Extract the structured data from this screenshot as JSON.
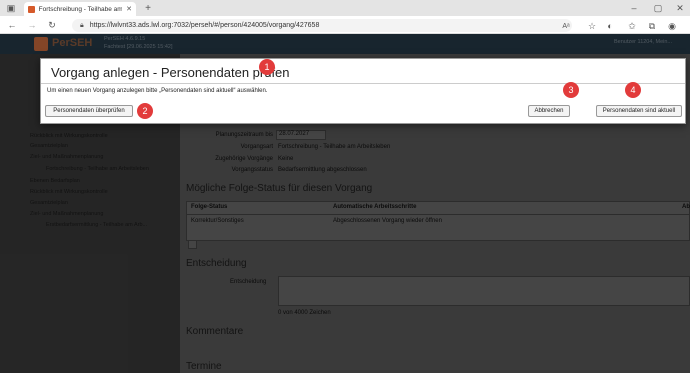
{
  "browser": {
    "tab_title": "Fortschreibung - Teilhabe am Arb...",
    "url": "https://lwlvnt33.ads.lwl.org:7032/perseh/#/person/424005/vorgang/427658"
  },
  "app": {
    "name": "PerSEH",
    "version": "PerSEH 4.6.9.15",
    "fachtest": "Fachtest [29.06.2025 15:42]",
    "user": "Benutzer 11204, Mein..."
  },
  "sidebar": {
    "items": [
      "Rückblick mit Wirkungskontrolle",
      "Gesamtzielplan",
      "Ziel- und Maßnahmenplanung",
      "Fortschreibung - Teilhabe am Arbeitsleben",
      "Ebenen Bedarfsplan",
      "Rückblick mit Wirkungskontrolle",
      "Gesamtzielplan",
      "Ziel- und Maßnahmenplanung",
      "Erstbedarfsermittlung - Teilhabe am Arb..."
    ]
  },
  "main": {
    "fields": [
      {
        "label": "Planungszeitraum bis",
        "value": "28.07.2027"
      },
      {
        "label": "Vorgangsart",
        "value": "Fortschreibung - Teilhabe am Arbeitsleben"
      },
      {
        "label": "Zugehörige Vorgänge",
        "value": "Keine"
      },
      {
        "label": "Vorgangsstatus",
        "value": "Bedarfsermittlung abgeschlossen"
      }
    ],
    "folge_title": "Mögliche Folge-Status für diesen Vorgang",
    "table": {
      "headers": [
        "Folge-Status",
        "Automatische Arbeitsschritte",
        "Ab"
      ],
      "rows": [
        [
          "Korrektur/Sonstiges",
          "Abgeschlossenen Vorgang wieder öffnen"
        ]
      ]
    },
    "entscheidung_title": "Entscheidung",
    "entscheidung_label": "Entscheidung",
    "char_count": "0 von 4000 Zeichen",
    "kommentare_title": "Kommentare",
    "termine_title": "Termine"
  },
  "dialog": {
    "title": "Vorgang anlegen - Personendaten prüfen",
    "text": "Um einen neuen Vorgang anzulegen bitte „Personendaten sind aktuell“ auswählen.",
    "btn_check": "Personendaten überprüfen",
    "btn_cancel": "Abbrechen",
    "btn_ok": "Personendaten sind aktuell"
  },
  "badges": [
    "1",
    "2",
    "3",
    "4"
  ],
  "colors": {
    "badge": "#e23b3b",
    "header": "#263a48"
  }
}
